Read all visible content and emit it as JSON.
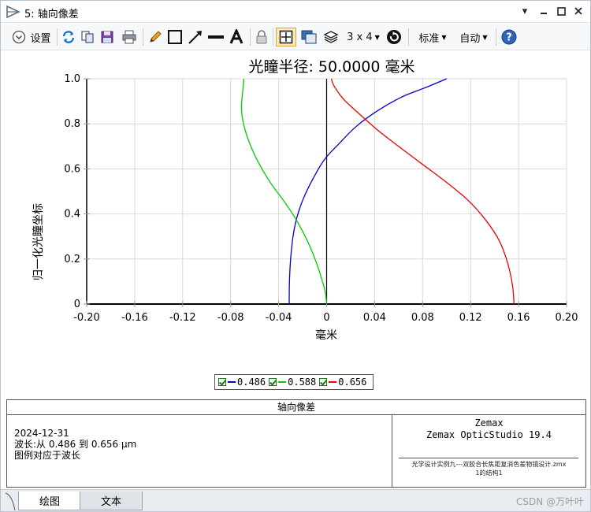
{
  "window": {
    "title": "5: 轴向像差"
  },
  "toolbar": {
    "settings_label": "设置",
    "layout_label": "3 x 4",
    "standard_label": "标准",
    "auto_label": "自动"
  },
  "legend": [
    {
      "label": "0.486",
      "color": "#0000cc"
    },
    {
      "label": "0.588",
      "color": "#00cc00"
    },
    {
      "label": "0.656",
      "color": "#ee0000"
    }
  ],
  "info": {
    "header": "轴向像差",
    "date": "2024-12-31",
    "wavelength": "波长:从 0.486 到 0.656 µm",
    "legend_note": "图例对应于波长",
    "brand1": "Zemax",
    "brand2": "Zemax OpticStudio 19.4",
    "file1": "光学设计实例九---双胶合长焦距复消色差物镜设计.zmx",
    "file2": "1的结构1"
  },
  "tabs": {
    "plot": "绘图",
    "text": "文本"
  },
  "watermark": "CSDN @万叶叶",
  "chart_data": {
    "type": "line",
    "title": "光瞳半径: 50.0000 毫米",
    "xlabel": "毫米",
    "ylabel": "归一化光瞳坐标",
    "xlim": [
      -0.2,
      0.2
    ],
    "ylim": [
      0,
      1.0
    ],
    "xticks": [
      -0.2,
      -0.16,
      -0.12,
      -0.08,
      -0.04,
      0,
      0.04,
      0.08,
      0.12,
      0.16,
      0.2
    ],
    "xtick_labels": [
      "-0.20",
      "-0.16",
      "-0.12",
      "-0.08",
      "-0.04",
      "0",
      "0.04",
      "0.08",
      "0.12",
      "0.16",
      "0.20"
    ],
    "yticks": [
      0,
      0.2,
      0.4,
      0.6,
      0.8,
      1.0
    ],
    "ytick_labels": [
      "0",
      "0.2",
      "0.4",
      "0.6",
      "0.8",
      "1.0"
    ],
    "grid": true,
    "series": [
      {
        "name": "0.486",
        "color": "#0000cc",
        "x": [
          -0.0312,
          -0.031,
          -0.03,
          -0.028,
          -0.025,
          -0.02,
          -0.012,
          -0.002,
          0.01,
          0.025,
          0.043,
          0.063,
          0.082,
          0.1
        ],
        "y": [
          0.0,
          0.1,
          0.2,
          0.3,
          0.38,
          0.46,
          0.55,
          0.64,
          0.71,
          0.79,
          0.86,
          0.92,
          0.96,
          1.0
        ]
      },
      {
        "name": "0.588",
        "color": "#00cc00",
        "x": [
          0.0,
          -0.001,
          -0.004,
          -0.009,
          -0.016,
          -0.026,
          -0.036,
          -0.047,
          -0.058,
          -0.066,
          -0.07,
          -0.071,
          -0.07,
          -0.069
        ],
        "y": [
          0.0,
          0.05,
          0.11,
          0.19,
          0.28,
          0.38,
          0.46,
          0.54,
          0.64,
          0.74,
          0.82,
          0.88,
          0.94,
          1.0
        ]
      },
      {
        "name": "0.656",
        "color": "#ee0000",
        "x": [
          0.1562,
          0.155,
          0.151,
          0.144,
          0.133,
          0.118,
          0.1,
          0.08,
          0.06,
          0.043,
          0.026,
          0.014,
          0.006,
          0.004
        ],
        "y": [
          0.0,
          0.08,
          0.18,
          0.28,
          0.37,
          0.46,
          0.54,
          0.62,
          0.7,
          0.77,
          0.85,
          0.91,
          0.97,
          1.0
        ]
      }
    ]
  }
}
